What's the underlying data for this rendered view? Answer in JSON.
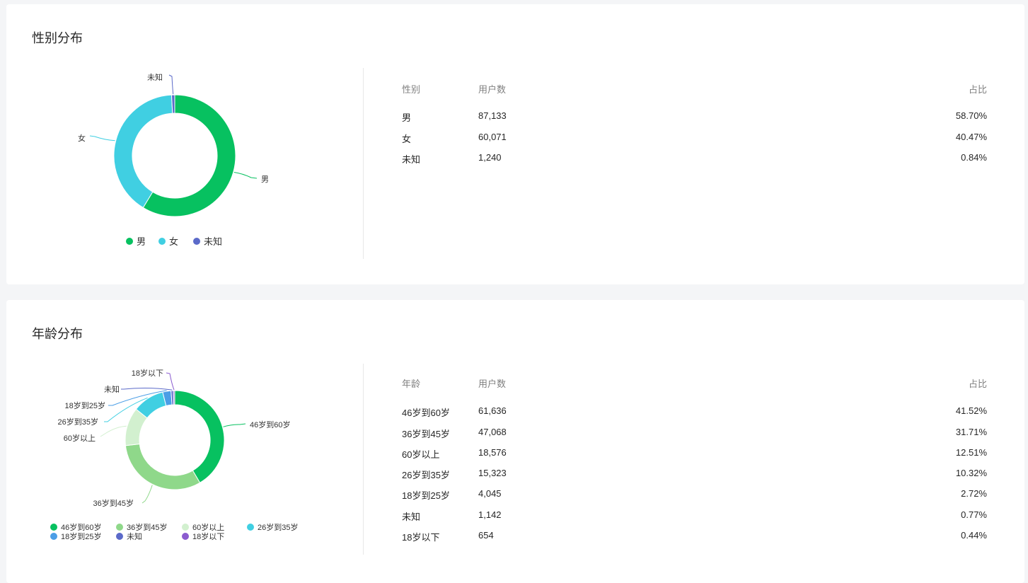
{
  "gender": {
    "title": "性别分布",
    "headers": [
      "性别",
      "用户数",
      "占比"
    ],
    "rows": [
      [
        "男",
        "87,133",
        "58.70%"
      ],
      [
        "女",
        "60,071",
        "40.47%"
      ],
      [
        "未知",
        "1,240",
        "0.84%"
      ]
    ]
  },
  "age": {
    "title": "年龄分布",
    "headers": [
      "年龄",
      "用户数",
      "占比"
    ],
    "rows": [
      [
        "46岁到60岁",
        "61,636",
        "41.52%"
      ],
      [
        "36岁到45岁",
        "47,068",
        "31.71%"
      ],
      [
        "60岁以上",
        "18,576",
        "12.51%"
      ],
      [
        "26岁到35岁",
        "15,323",
        "10.32%"
      ],
      [
        "18岁到25岁",
        "4,045",
        "2.72%"
      ],
      [
        "未知",
        "1,142",
        "0.77%"
      ],
      [
        "18岁以下",
        "654",
        "0.44%"
      ]
    ]
  },
  "chart_data": [
    {
      "type": "pie",
      "title": "性别分布",
      "categories": [
        "男",
        "女",
        "未知"
      ],
      "values": [
        87133,
        60071,
        1240
      ],
      "colors": [
        "#07c160",
        "#40cfe2",
        "#5b6ac9"
      ],
      "legend": "bottom"
    },
    {
      "type": "pie",
      "title": "年龄分布",
      "categories": [
        "46岁到60岁",
        "36岁到45岁",
        "60岁以上",
        "26岁到35岁",
        "18岁到25岁",
        "未知",
        "18岁以下"
      ],
      "values": [
        61636,
        47068,
        18576,
        15323,
        4045,
        1142,
        654
      ],
      "colors": [
        "#07c160",
        "#8fd88a",
        "#d2f0cf",
        "#40cfe2",
        "#4b9ee6",
        "#5b6ac9",
        "#8b5ccf"
      ],
      "legend": "bottom"
    }
  ]
}
